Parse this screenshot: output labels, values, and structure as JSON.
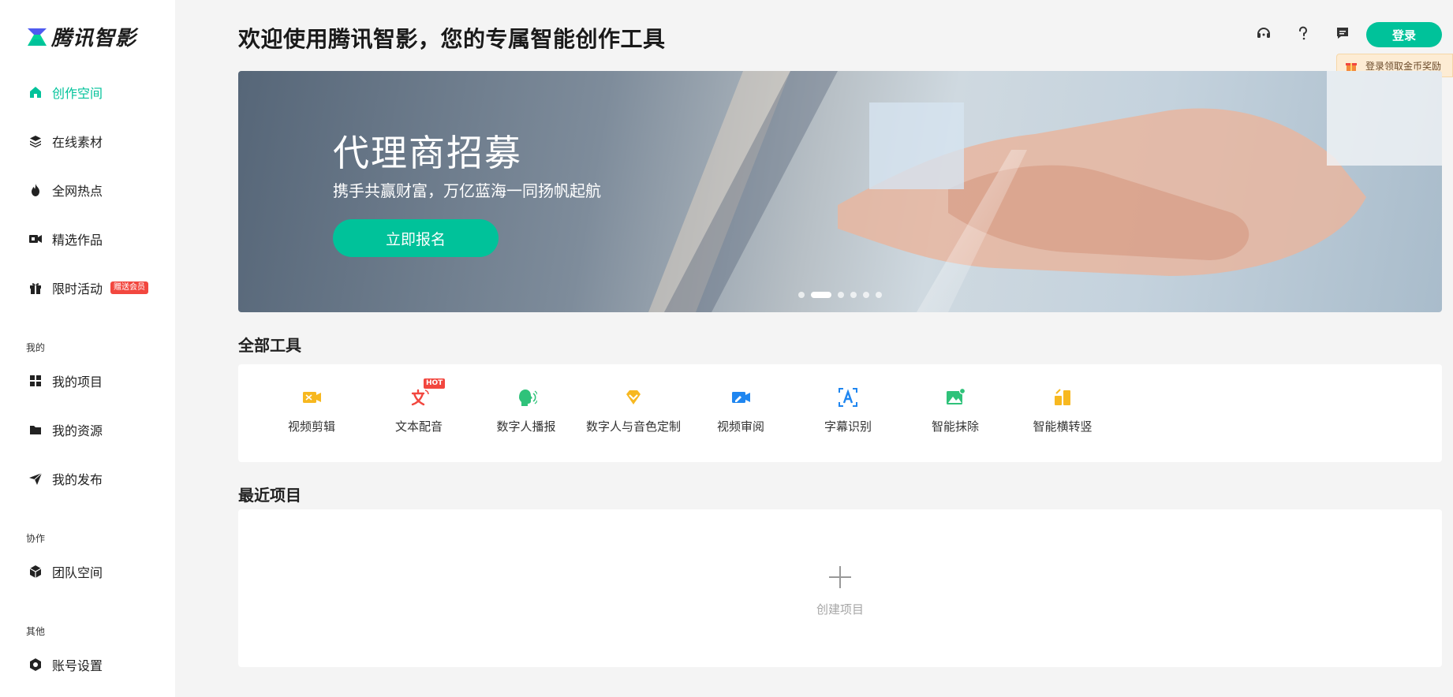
{
  "brand": {
    "name": "腾讯智影",
    "accent": "#00c29a",
    "logo_icon": "tencent-zhiying-logo"
  },
  "sidebar": {
    "items": [
      {
        "label": "创作空间",
        "icon": "home-icon",
        "active": true
      },
      {
        "label": "在线素材",
        "icon": "layers-icon"
      },
      {
        "label": "全网热点",
        "icon": "fire-icon"
      },
      {
        "label": "精选作品",
        "icon": "video-camera-icon"
      },
      {
        "label": "限时活动",
        "icon": "gift-icon",
        "badge": "赠送会员"
      }
    ],
    "groups": [
      {
        "label": "我的",
        "items": [
          {
            "label": "我的项目",
            "icon": "grid-icon"
          },
          {
            "label": "我的资源",
            "icon": "folder-icon"
          },
          {
            "label": "我的发布",
            "icon": "send-icon"
          }
        ]
      },
      {
        "label": "协作",
        "items": [
          {
            "label": "团队空间",
            "icon": "cube-icon"
          }
        ]
      },
      {
        "label": "其他",
        "items": [
          {
            "label": "账号设置",
            "icon": "settings-icon"
          }
        ]
      }
    ]
  },
  "header": {
    "title": "欢迎使用腾讯智影，您的专属智能创作工具",
    "icons": [
      "headset-icon",
      "help-icon",
      "message-icon"
    ],
    "login_label": "登录",
    "login_tip": "登录领取金币奖励"
  },
  "banner": {
    "title": "代理商招募",
    "subtitle": "携手共赢财富，万亿蓝海一同扬帆起航",
    "button_label": "立即报名",
    "slide_count": 6,
    "active_slide": 2
  },
  "tools": {
    "section_title": "全部工具",
    "items": [
      {
        "label": "视频剪辑",
        "icon": "video-edit-icon",
        "color": "#f7b820"
      },
      {
        "label": "文本配音",
        "icon": "text-voice-icon",
        "color": "#f2473f",
        "badge": "HOT"
      },
      {
        "label": "数字人播报",
        "icon": "digital-human-icon",
        "color": "#2fc27a"
      },
      {
        "label": "数字人与音色定制",
        "icon": "diamond-icon",
        "color": "#f7b820"
      },
      {
        "label": "视频审阅",
        "icon": "video-review-icon",
        "color": "#1f86f0"
      },
      {
        "label": "字幕识别",
        "icon": "subtitle-icon",
        "color": "#1f86f0"
      },
      {
        "label": "智能抹除",
        "icon": "image-erase-icon",
        "color": "#2fc27a"
      },
      {
        "label": "智能横转竖",
        "icon": "rotate-layout-icon",
        "color": "#f7b820"
      }
    ]
  },
  "recent": {
    "section_title": "最近项目",
    "create_label": "创建项目"
  }
}
